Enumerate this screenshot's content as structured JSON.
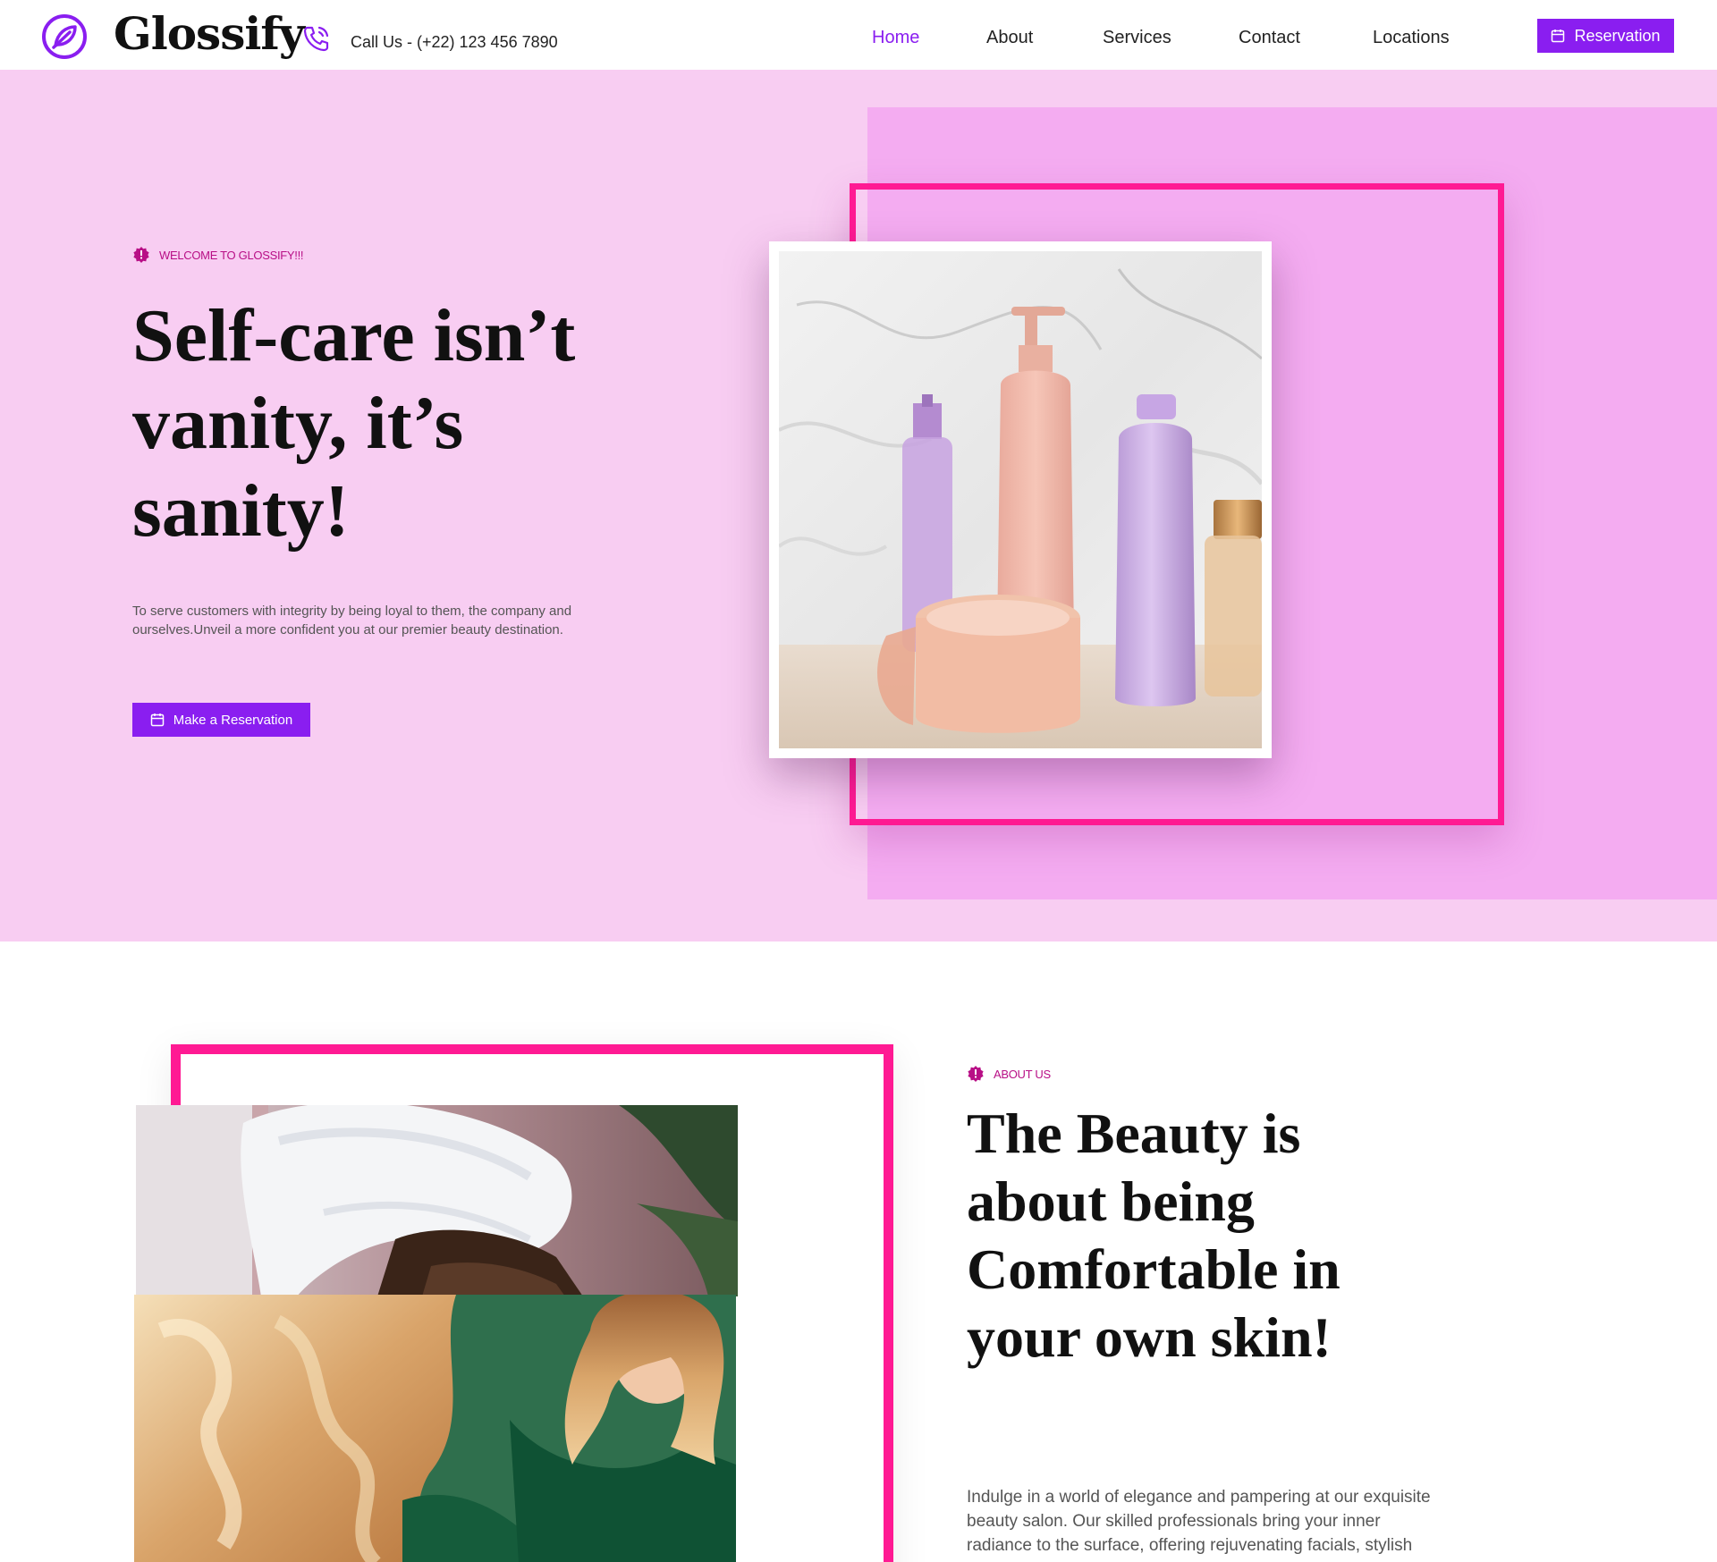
{
  "brand": {
    "name": "Glossify",
    "accent": "#8a1ef0",
    "pink": "#ff1a93"
  },
  "header": {
    "call_text": "Call Us - (+22) 123 456 7890",
    "nav": [
      {
        "label": "Home",
        "active": true
      },
      {
        "label": "About",
        "active": false
      },
      {
        "label": "Services",
        "active": false
      },
      {
        "label": "Contact",
        "active": false
      },
      {
        "label": "Locations",
        "active": false
      }
    ],
    "reservation_label": "Reservation"
  },
  "hero": {
    "eyebrow": "WELCOME TO GLOSSIFY!!!",
    "title": "Self-care isn’t vanity, it’s sanity!",
    "description": "To serve customers with integrity by being loyal to them, the company and ourselves.Unveil a more confident you at our premier beauty destination.",
    "cta_label": "Make a Reservation"
  },
  "about": {
    "eyebrow": "ABOUT US",
    "title": "The Beauty is about being Comfortable in your own skin!",
    "description": "Indulge in a world of elegance and pampering at our exquisite beauty salon. Our skilled professionals bring your inner radiance to the surface, offering rejuvenating facials, stylish"
  }
}
